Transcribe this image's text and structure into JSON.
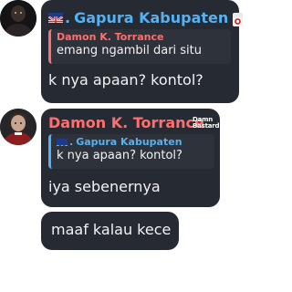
{
  "messages": [
    {
      "sender": "Gapura Kabupaten",
      "sender_prefix": ".",
      "reply_to": {
        "sender": "Damon K. Torrance",
        "text": "emang ngambil dari situ"
      },
      "text": "k nya apaan? kontol?"
    },
    {
      "sender": "Damon K. Torrance",
      "badge_line1": "Damn",
      "badge_line2": "Bastard",
      "reply_to": {
        "sender": "Gapura Kabupaten",
        "sender_prefix": ".",
        "text": "k nya apaan? kontol?"
      },
      "text": "iya sebenernya"
    },
    {
      "text": "maaf kalau kece"
    }
  ],
  "icons": {
    "uk_flag": "uk-flag-icon",
    "round_badge": "round-badge-icon"
  },
  "colors": {
    "bubble": "#262a33",
    "gapura": "#55b2f2",
    "damon": "#ff6f6f",
    "text": "#f2f2f2"
  }
}
